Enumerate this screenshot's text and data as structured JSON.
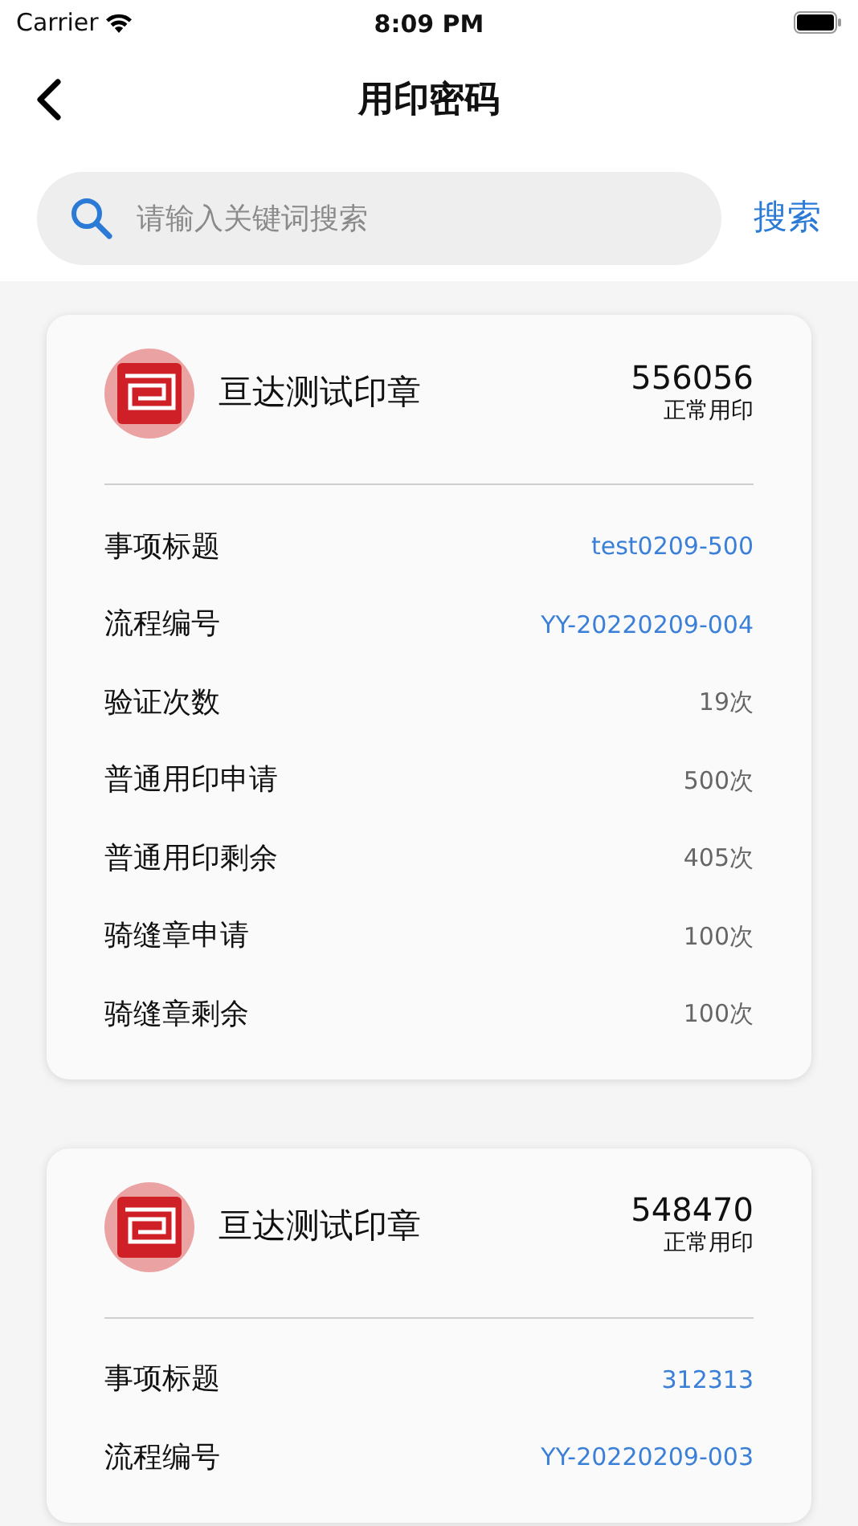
{
  "status_bar": {
    "carrier": "Carrier",
    "time": "8:09 PM"
  },
  "nav": {
    "title": "用印密码"
  },
  "search": {
    "placeholder": "请输入关键词搜索",
    "button": "搜索"
  },
  "cards": [
    {
      "name": "亘达测试印章",
      "code": "556056",
      "status": "正常用印",
      "rows": [
        {
          "label": "事项标题",
          "value": "test0209-500",
          "kind": "link"
        },
        {
          "label": "流程编号",
          "value": "YY-20220209-004",
          "kind": "link"
        },
        {
          "label": "验证次数",
          "value": "19次",
          "kind": "count"
        },
        {
          "label": "普通用印申请",
          "value": "500次",
          "kind": "count"
        },
        {
          "label": "普通用印剩余",
          "value": "405次",
          "kind": "count"
        },
        {
          "label": "骑缝章申请",
          "value": "100次",
          "kind": "count"
        },
        {
          "label": "骑缝章剩余",
          "value": "100次",
          "kind": "count"
        }
      ]
    },
    {
      "name": "亘达测试印章",
      "code": "548470",
      "status": "正常用印",
      "rows": [
        {
          "label": "事项标题",
          "value": "312313",
          "kind": "link"
        },
        {
          "label": "流程编号",
          "value": "YY-20220209-003",
          "kind": "link"
        }
      ]
    }
  ]
}
